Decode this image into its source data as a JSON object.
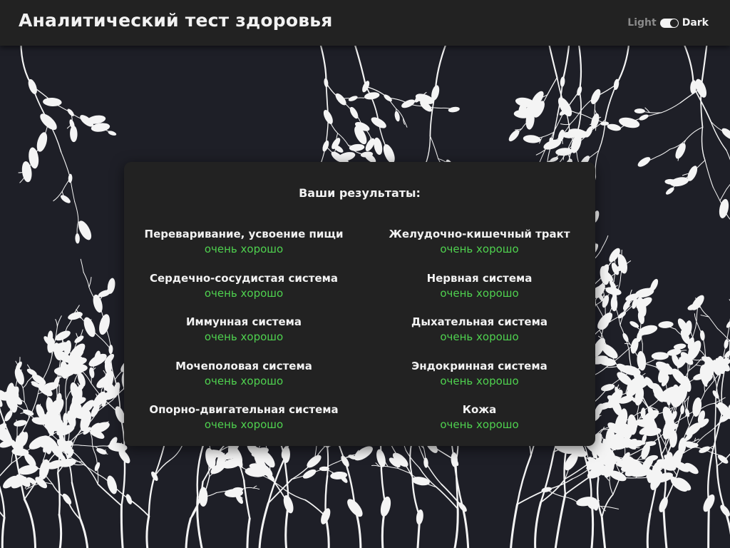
{
  "header": {
    "title": "Аналитический тест здоровья",
    "theme_light_label": "Light",
    "theme_dark_label": "Dark"
  },
  "results": {
    "heading": "Ваши результаты:",
    "items": [
      {
        "name": "Переваривание, усвоение пищи",
        "value": "очень хорошо"
      },
      {
        "name": "Желудочно-кишечный тракт",
        "value": "очень хорошо"
      },
      {
        "name": "Сердечно-сосудистая система",
        "value": "очень хорошо"
      },
      {
        "name": "Нервная система",
        "value": "очень хорошо"
      },
      {
        "name": "Иммунная система",
        "value": "очень хорошо"
      },
      {
        "name": "Дыхательная система",
        "value": "очень хорошо"
      },
      {
        "name": "Мочеполовая система",
        "value": "очень хорошо"
      },
      {
        "name": "Эндокринная система",
        "value": "очень хорошо"
      },
      {
        "name": "Опорно-двигательная система",
        "value": "очень хорошо"
      },
      {
        "name": "Кожа",
        "value": "очень хорошо"
      }
    ]
  },
  "colors": {
    "background": "#1e1f27",
    "header": "#222222",
    "card": "#222222",
    "text": "#f2f2f2",
    "value_good": "#4fd14f"
  }
}
